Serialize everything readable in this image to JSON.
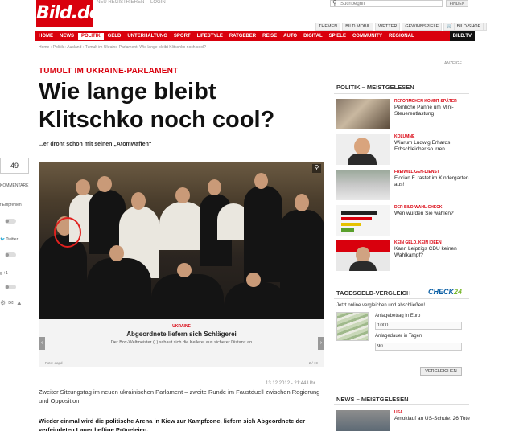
{
  "header": {
    "logo": "Bild.de",
    "links": [
      "NEU REGISTRIEREN",
      "LOGIN"
    ],
    "search_placeholder": "Suchbegriff",
    "search_button": "FINDEN",
    "services": [
      "THEMEN",
      "BILD MOBIL",
      "WETTER",
      "GEWINNSPIELE",
      "BILD-SHOP"
    ]
  },
  "nav": {
    "items": [
      "HOME",
      "NEWS",
      "POLITIK",
      "GELD",
      "UNTERHALTUNG",
      "SPORT",
      "LIFESTYLE",
      "RATGEBER",
      "REISE",
      "AUTO",
      "DIGITAL",
      "SPIELE",
      "COMMUNITY",
      "REGIONAL"
    ],
    "active": "POLITIK",
    "tv": "BILD.TV"
  },
  "breadcrumb": "Home › Politik › Ausland › Tumult im Ukraine-Parlament: Wie lange bleibt Klitschko noch cool?",
  "social": {
    "count": "49",
    "kommentare": "KOMMENTARE",
    "empfehlen": "Empfehlen",
    "twitter": "Twitter",
    "gplus": "+1"
  },
  "article": {
    "kicker": "TUMULT IM UKRAINE-PARLAMENT",
    "headline_1": "Wie lange bleibt",
    "headline_2": "Klitschko noch cool?",
    "subline": "...er droht schon mit seinen „Atomwaffen“",
    "caption_kicker": "UKRAINE",
    "caption_title": "Abgeordnete liefern sich Schlägerei",
    "caption_text": "Der Box-Weltmeister (l.) schaut sich die Keilerei aus sicherer Distanz an",
    "foto": "Foto: dapd",
    "pages": "2 / 19",
    "dateline": "13.12.2012 - 21:44 Uhr",
    "lead": "Zweiter Sitzungstag im neuen ukrainischen Parlament – zweite Runde im Faustduell zwischen Regierung und Opposition.",
    "lead2": "Wieder einmal wird die politische Arena in Kiew zur Kampfzone, liefern sich Abgeordnete der verfeindeten Lager heftige Prügeleien."
  },
  "right": {
    "anzeige": "ANZEIGE",
    "politik_title": "POLITIK – MEISTGELESEN",
    "items": [
      {
        "kicker": "REFORMCHEN KOMMT SPÄTER",
        "title": "Peinliche Panne um Mini-Steuerentlastung"
      },
      {
        "kicker": "KOLUMNE",
        "title": "Wiarum Ludwig Erhards Erbschleicher so irren"
      },
      {
        "kicker": "FREIWILLIGEN-DIENST",
        "title": "Florian F. rastet im Kindergarten aus!"
      },
      {
        "kicker": "DER BILD-WAHL-CHECK",
        "title": "Wen würden Sie wählen?"
      },
      {
        "kicker": "KEIN GELD, KEIN IDEEN",
        "title": "Kann Leipzigs CDU keinen Wahlkampf?"
      }
    ],
    "tagesgeld_title": "TAGESGELD-VERGLEICH",
    "check24_a": "CHECK",
    "check24_b": "24",
    "tagesgeld_sub": "Jetzt online vergleichen und abschließen!",
    "anlagebetrag_label": "Anlagebetrag in Euro",
    "anlagebetrag_value": "1000",
    "anlagedauer_label": "Anlagedauer in Tagen",
    "anlagedauer_value": "90",
    "vergleichen": "VERGLEICHEN",
    "news_title": "NEWS – MEISTGELESEN",
    "news_kicker": "USA",
    "news_item": "Amoklauf an US-Schule: 26 Tote"
  }
}
